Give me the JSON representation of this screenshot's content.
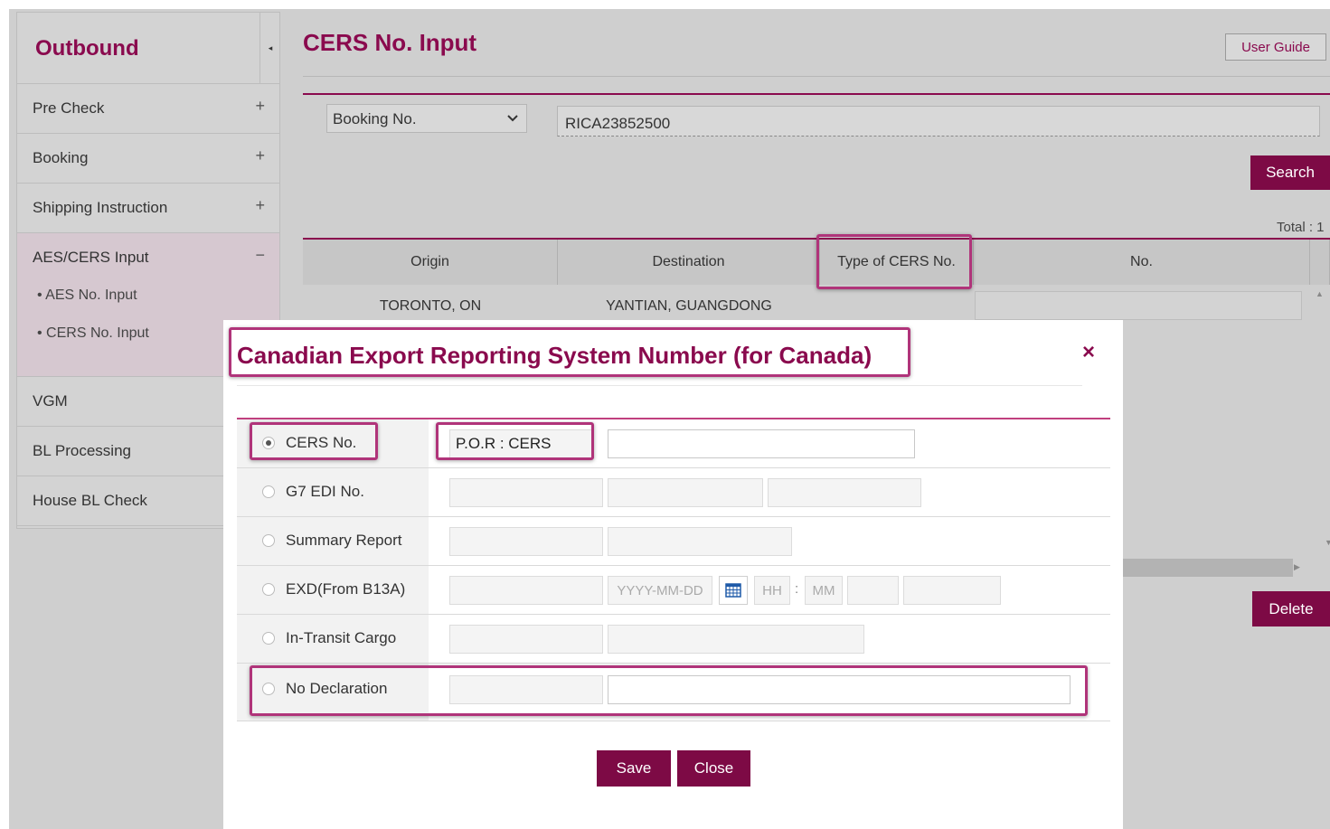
{
  "sidebar": {
    "title": "Outbound",
    "collapse_icon": "◂",
    "items": [
      {
        "label": "Pre Check",
        "toggle": "+"
      },
      {
        "label": "Booking",
        "toggle": "+"
      },
      {
        "label": "Shipping Instruction",
        "toggle": "+"
      },
      {
        "label": "AES/CERS Input",
        "toggle": "−",
        "children": [
          "• AES No. Input",
          "• CERS No. Input"
        ]
      },
      {
        "label": "VGM"
      },
      {
        "label": "BL Processing"
      },
      {
        "label": "House BL Check"
      }
    ]
  },
  "header": {
    "title": "CERS No. Input",
    "user_guide": "User Guide"
  },
  "search": {
    "type": "Booking No.",
    "value": "RICA23852500",
    "button": "Search"
  },
  "results": {
    "total": "Total : 1",
    "columns": [
      "Origin",
      "Destination",
      "Type of CERS No.",
      "No."
    ],
    "rows": [
      {
        "origin": "TORONTO, ON",
        "destination": "YANTIAN, GUANGDONG"
      }
    ],
    "delete_button": "Delete"
  },
  "modal": {
    "title": "Canadian Export Reporting System Number (for Canada)",
    "close_icon": "×",
    "options": [
      {
        "label": "CERS No.",
        "selected": true,
        "prefix": "P.O.R : CERS"
      },
      {
        "label": "G7 EDI No."
      },
      {
        "label": "Summary Report"
      },
      {
        "label": "EXD(From B13A)",
        "date_placeholder": "YYYY-MM-DD",
        "hour_placeholder": "HH",
        "colon": ":",
        "minute_placeholder": "MM"
      },
      {
        "label": "In-Transit Cargo"
      },
      {
        "label": "No Declaration"
      }
    ],
    "save": "Save",
    "close": "Close"
  },
  "colors": {
    "brand": "#7d0a45",
    "accent": "#8a0a4e",
    "highlight": "#b0347a"
  }
}
